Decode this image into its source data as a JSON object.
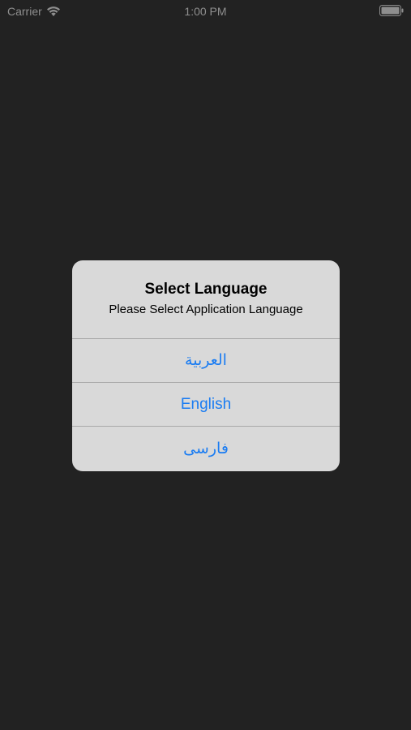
{
  "status_bar": {
    "carrier": "Carrier",
    "time": "1:00 PM"
  },
  "alert": {
    "title": "Select Language",
    "message": "Please Select Application Language",
    "actions": [
      {
        "label": "العربية"
      },
      {
        "label": "English"
      },
      {
        "label": "فارسى"
      }
    ]
  },
  "colors": {
    "background": "#222222",
    "alert_background": "#d9d9d9",
    "action_text": "#1a7cf2",
    "status_text": "#8e8e8e"
  }
}
